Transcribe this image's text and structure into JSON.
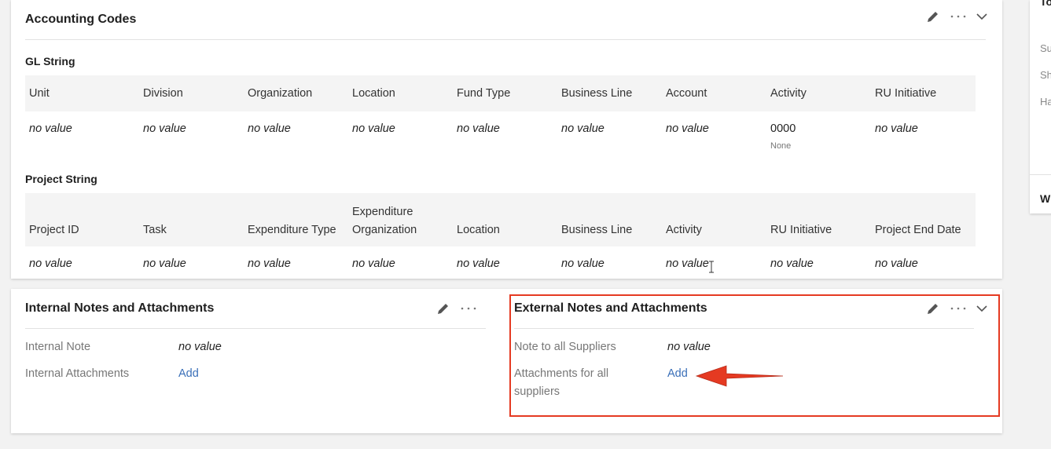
{
  "accounting": {
    "title": "Accounting Codes",
    "gl": {
      "title": "GL String",
      "headers": [
        "Unit",
        "Division",
        "Organization",
        "Location",
        "Fund Type",
        "Business Line",
        "Account",
        "Activity",
        "RU Initiative"
      ],
      "values": [
        "no value",
        "no value",
        "no value",
        "no value",
        "no value",
        "no value",
        "no value",
        "0000",
        "no value"
      ],
      "activity_sub": "None"
    },
    "project": {
      "title": "Project String",
      "headers": [
        "Project ID",
        "Task",
        "Expenditure Type",
        "Expenditure",
        "Location",
        "Business Line",
        "Activity",
        "RU Initiative",
        "Project End Date"
      ],
      "header_4_line2": "Organization",
      "values": [
        "no value",
        "no value",
        "no value",
        "no value",
        "no value",
        "no value",
        "no value",
        "no value",
        "no value"
      ]
    }
  },
  "internal": {
    "title": "Internal Notes and Attachments",
    "note_label": "Internal Note",
    "note_value": "no value",
    "attach_label": "Internal Attachments",
    "attach_link": "Add"
  },
  "external": {
    "title": "External Notes and Attachments",
    "note_label": "Note to all Suppliers",
    "note_value": "no value",
    "attach_label_line1": "Attachments for all",
    "attach_label_line2": "suppliers",
    "attach_link": "Add"
  },
  "side": {
    "title": "To",
    "rows": [
      "Su",
      "Sh",
      "Ha"
    ],
    "footer": "Wi"
  },
  "icons": {
    "edit": "pencil-icon",
    "more": "more-horizontal-icon",
    "collapse": "chevron-down-icon"
  },
  "colors": {
    "highlight": "#e53a22",
    "link": "#3a6fb8"
  }
}
